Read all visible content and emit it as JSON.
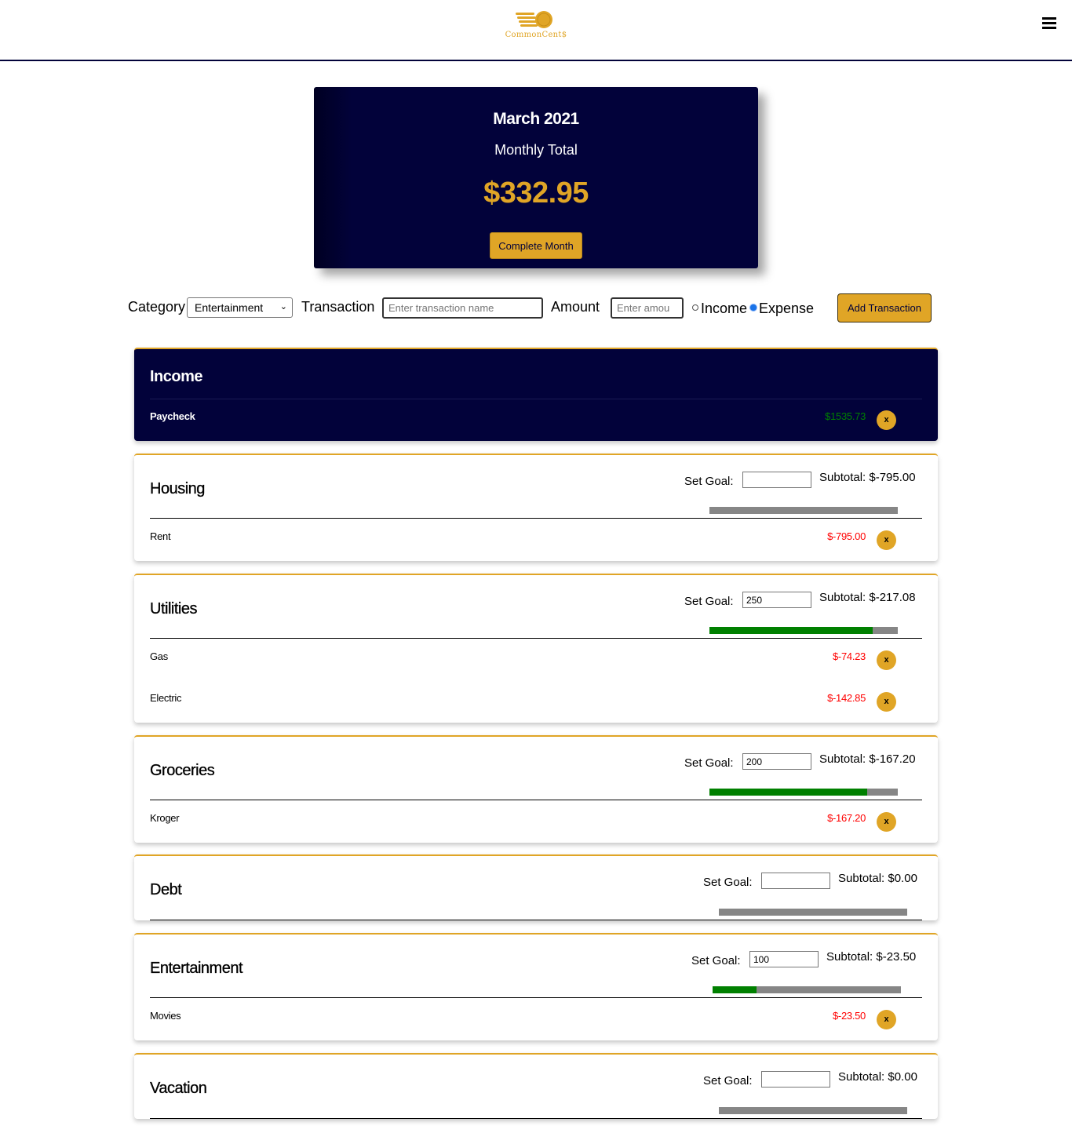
{
  "header": {
    "logo_text": "CommonCent$",
    "menu_icon": "hamburger-menu-icon"
  },
  "summary": {
    "month": "March 2021",
    "subtitle": "Monthly Total",
    "total": "$332.95",
    "complete_button": "Complete Month"
  },
  "form": {
    "category_label": "Category",
    "category_selected": "Entertainment",
    "transaction_label": "Transaction",
    "transaction_placeholder": "Enter transaction name",
    "amount_label": "Amount",
    "amount_placeholder": "Enter amou",
    "income_label": "Income",
    "expense_label": "Expense",
    "type_selected": "Expense",
    "add_button": "Add Transaction"
  },
  "goal_label": "Set Goal:",
  "delete_label": "x",
  "colors": {
    "navy": "#02023a",
    "gold": "#e0a526",
    "positive": "#008000",
    "negative": "#ff0000",
    "bar_track": "#868686"
  },
  "categories": [
    {
      "name": "Income",
      "items": [
        {
          "name": "Paycheck",
          "amount": "$1535.73"
        }
      ]
    },
    {
      "name": "Housing",
      "goal": "",
      "subtotal": "Subtotal: $-795.00",
      "progress": 0,
      "items": [
        {
          "name": "Rent",
          "amount": "$-795.00"
        }
      ]
    },
    {
      "name": "Utilities",
      "goal": "250",
      "subtotal": "Subtotal: $-217.08",
      "progress": 0.868,
      "items": [
        {
          "name": "Gas",
          "amount": "$-74.23"
        },
        {
          "name": "Electric",
          "amount": "$-142.85"
        }
      ]
    },
    {
      "name": "Groceries",
      "goal": "200",
      "subtotal": "Subtotal: $-167.20",
      "progress": 0.836,
      "items": [
        {
          "name": "Kroger",
          "amount": "$-167.20"
        }
      ]
    },
    {
      "name": "Debt",
      "goal": "",
      "subtotal": "Subtotal: $0.00",
      "progress": 0,
      "items": []
    },
    {
      "name": "Entertainment",
      "goal": "100",
      "subtotal": "Subtotal: $-23.50",
      "progress": 0.235,
      "items": [
        {
          "name": "Movies",
          "amount": "$-23.50"
        }
      ]
    },
    {
      "name": "Vacation",
      "goal": "",
      "subtotal": "Subtotal: $0.00",
      "progress": 0,
      "items": []
    }
  ]
}
